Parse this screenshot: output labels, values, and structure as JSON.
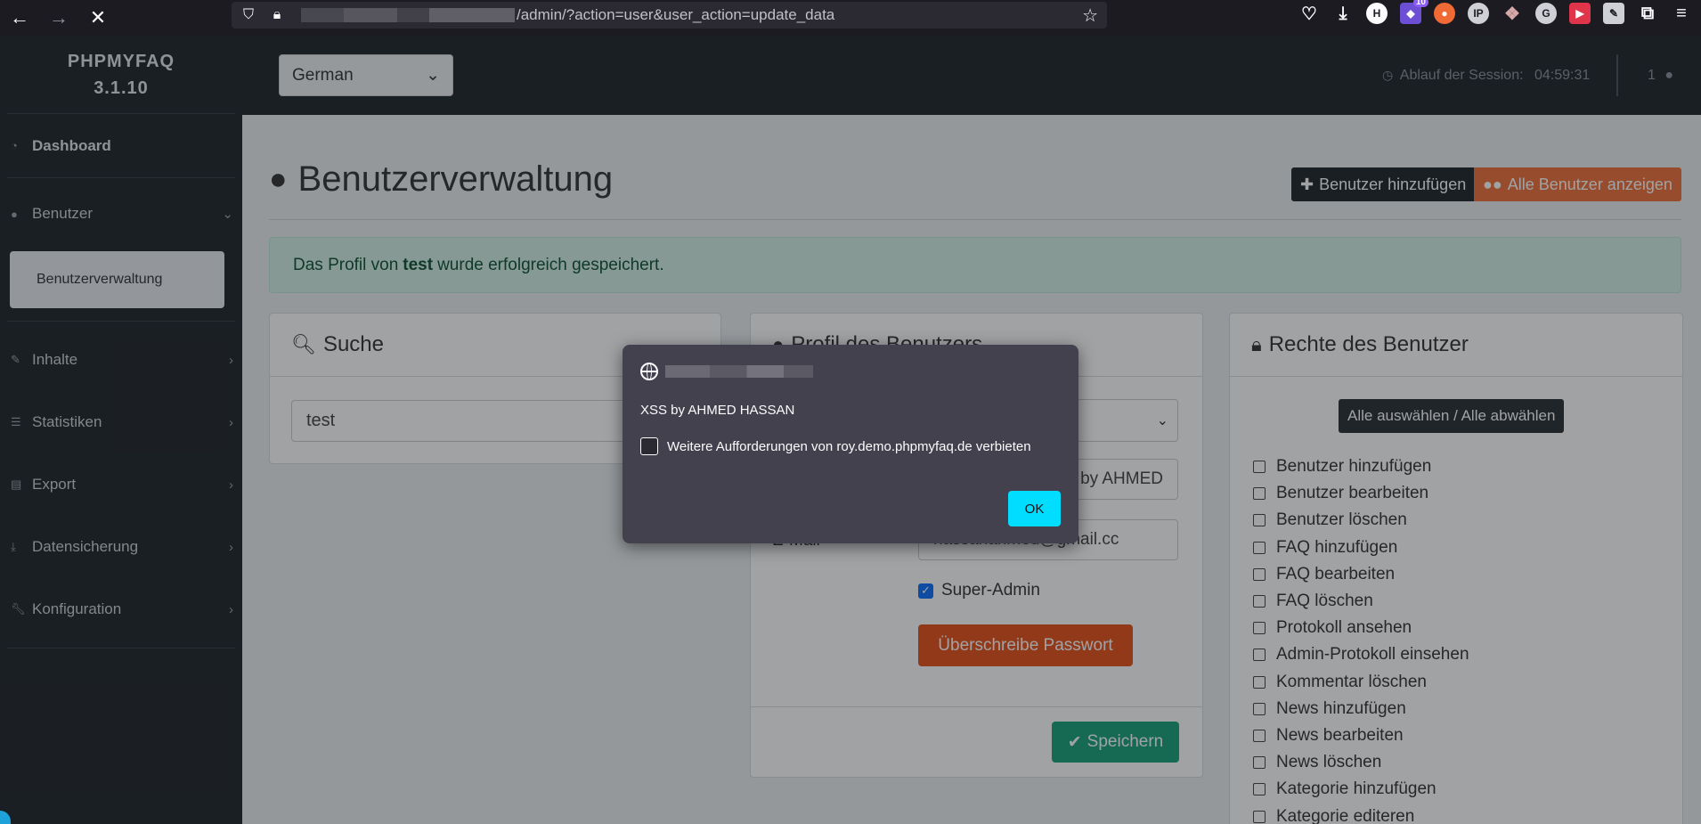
{
  "browser": {
    "url_path": "/admin/?action=user&user_action=update_data",
    "ext_badge": "10"
  },
  "sidebar": {
    "brand_name": "PHPMYFAQ",
    "brand_version": "3.1.10",
    "dashboard": "Dashboard",
    "users": "Benutzer",
    "user_admin": "Benutzerverwaltung",
    "items": [
      "Inhalte",
      "Statistiken",
      "Export",
      "Datensicherung",
      "Konfiguration"
    ]
  },
  "header": {
    "language": "German",
    "session_label": "Ablauf der Session:",
    "session_time": "04:59:31",
    "user_count": "1"
  },
  "main": {
    "title": "Benutzerverwaltung",
    "add_user": "Benutzer hinzufügen",
    "show_all": "Alle Benutzer anzeigen",
    "alert_pre": "Das Profil von",
    "alert_user": "test",
    "alert_post": "wurde erfolgreich gespeichert."
  },
  "search_card": {
    "title": "Suche",
    "value": "test"
  },
  "profile_card": {
    "title": "Profil des Benutzers",
    "name_fragment": "by AHMED",
    "email_label": "E-Mail",
    "email_fragment": "hassanahmed@gmail.cc",
    "super_admin": "Super-Admin",
    "overwrite_password": "Überschreibe Passwort",
    "save": "Speichern"
  },
  "rights_card": {
    "title": "Rechte des Benutzer",
    "select_all": "Alle auswählen / Alle abwählen",
    "permissions": [
      "Benutzer hinzufügen",
      "Benutzer bearbeiten",
      "Benutzer löschen",
      "FAQ hinzufügen",
      "FAQ bearbeiten",
      "FAQ löschen",
      "Protokoll ansehen",
      "Admin-Protokoll einsehen",
      "Kommentar löschen",
      "News hinzufügen",
      "News bearbeiten",
      "News löschen",
      "Kategorie hinzufügen",
      "Kategorie editeren"
    ]
  },
  "dialog": {
    "message": "XSS by AHMED HASSAN",
    "checkbox_label": "Weitere Aufforderungen von roy.demo.phpmyfaq.de verbieten",
    "ok": "OK"
  }
}
